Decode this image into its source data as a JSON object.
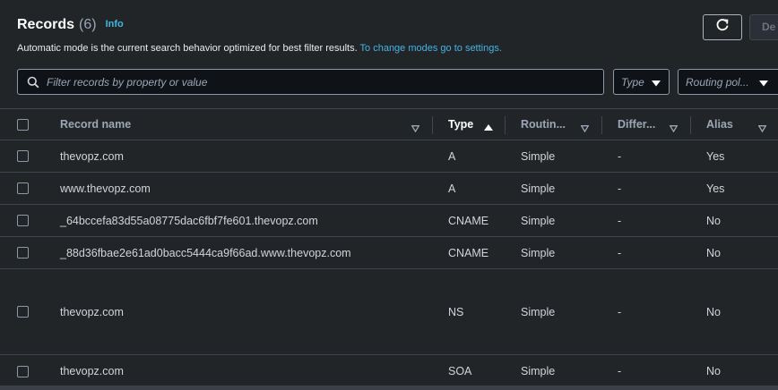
{
  "header": {
    "title": "Records",
    "count": "(6)",
    "info_label": "Info",
    "description": "Automatic mode is the current search behavior optimized for best filter results.",
    "description_link": "To change modes go to settings.",
    "delete_label": "De"
  },
  "filters": {
    "search_placeholder": "Filter records by property or value",
    "type_label": "Type",
    "routing_label": "Routing pol..."
  },
  "columns": {
    "record_name": "Record name",
    "type": "Type",
    "routing": "Routin...",
    "differ": "Differ...",
    "alias": "Alias"
  },
  "records": [
    {
      "name": "thevopz.com",
      "type": "A",
      "routing": "Simple",
      "differ": "-",
      "alias": "Yes"
    },
    {
      "name": "www.thevopz.com",
      "type": "A",
      "routing": "Simple",
      "differ": "-",
      "alias": "Yes"
    },
    {
      "name": "_64bccefa83d55a08775dac6fbf7fe601.thevopz.com",
      "type": "CNAME",
      "routing": "Simple",
      "differ": "-",
      "alias": "No"
    },
    {
      "name": "_88d36fbae2e61ad0bacc5444ca9f66ad.www.thevopz.com",
      "type": "CNAME",
      "routing": "Simple",
      "differ": "-",
      "alias": "No"
    },
    {
      "name": "thevopz.com",
      "type": "NS",
      "routing": "Simple",
      "differ": "-",
      "alias": "No"
    },
    {
      "name": "thevopz.com",
      "type": "SOA",
      "routing": "Simple",
      "differ": "-",
      "alias": "No"
    }
  ],
  "icons": {
    "refresh": "refresh-icon",
    "search": "search-icon",
    "caret": "caret-down-icon",
    "sort": "sort-icon"
  },
  "colors": {
    "link": "#42b4e6",
    "background": "#222527"
  }
}
